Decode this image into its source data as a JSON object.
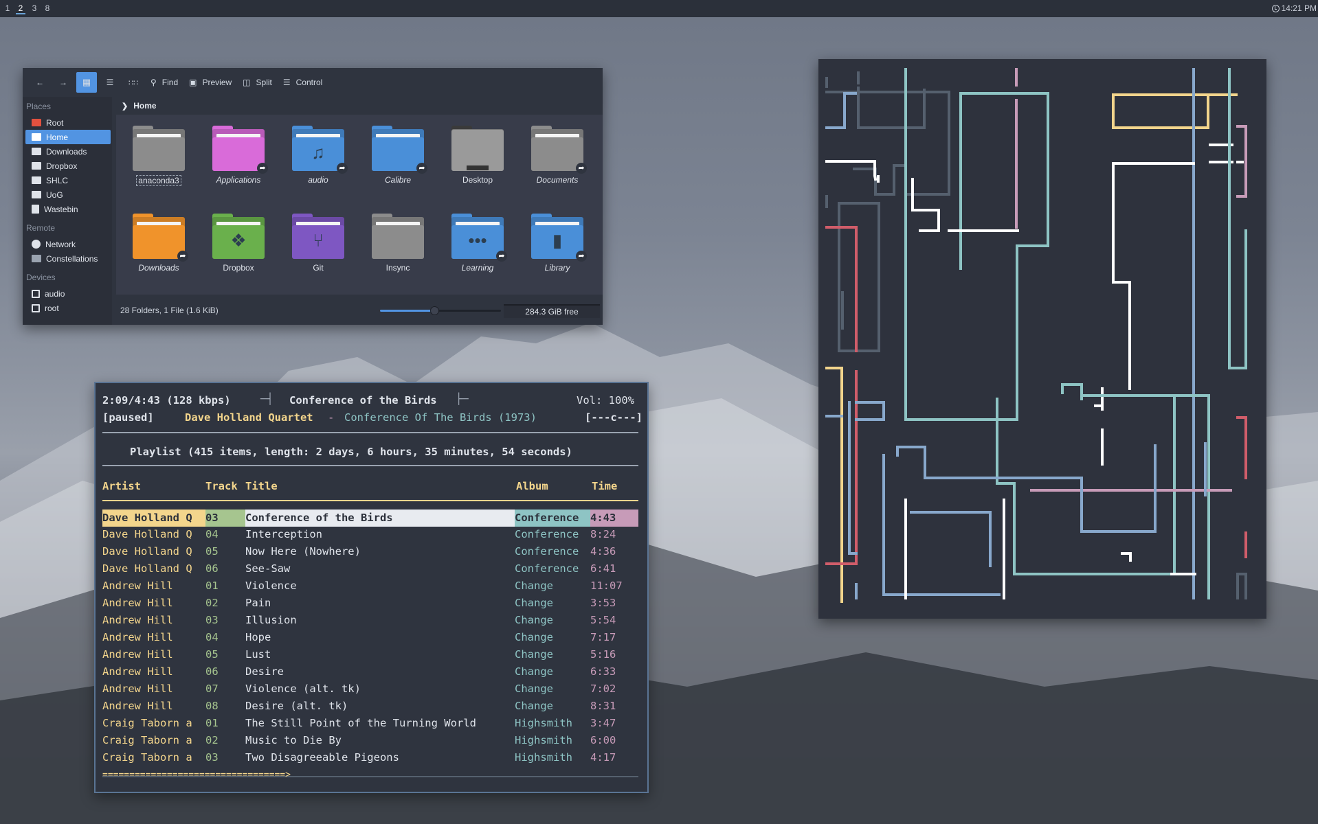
{
  "topbar": {
    "workspaces": [
      "1",
      "2",
      "3",
      "8"
    ],
    "active_workspace": "2",
    "clock": "14:21 PM"
  },
  "file_manager": {
    "toolbar": {
      "find": "Find",
      "preview": "Preview",
      "split": "Split",
      "control": "Control"
    },
    "sidebar": {
      "places_header": "Places",
      "places": [
        {
          "label": "Root",
          "icon": "folder-red-icon"
        },
        {
          "label": "Home",
          "icon": "home-icon",
          "selected": true
        },
        {
          "label": "Downloads",
          "icon": "folder-icon"
        },
        {
          "label": "Dropbox",
          "icon": "folder-icon"
        },
        {
          "label": "SHLC",
          "icon": "folder-icon"
        },
        {
          "label": "UoG",
          "icon": "folder-icon"
        },
        {
          "label": "Wastebin",
          "icon": "trash-icon"
        }
      ],
      "remote_header": "Remote",
      "remote": [
        {
          "label": "Network",
          "icon": "globe-icon"
        },
        {
          "label": "Constellations",
          "icon": "server-icon"
        }
      ],
      "devices_header": "Devices",
      "devices": [
        {
          "label": "audio",
          "icon": "drive-icon"
        },
        {
          "label": "root",
          "icon": "drive-icon"
        }
      ]
    },
    "breadcrumb": "Home",
    "items": [
      {
        "name": "anaconda3",
        "color": "#8c8c8c"
      },
      {
        "name": "Applications",
        "color": "#d96bd9"
      },
      {
        "name": "audio",
        "color": "#4a8fd8"
      },
      {
        "name": "Calibre",
        "color": "#4a8fd8"
      },
      {
        "name": "Desktop",
        "color": "#8c8c8c"
      },
      {
        "name": "Documents",
        "color": "#8c8c8c"
      },
      {
        "name": "Downloads",
        "color": "#f0932b"
      },
      {
        "name": "Dropbox",
        "color": "#6ab04c"
      },
      {
        "name": "Git",
        "color": "#7e57c2"
      },
      {
        "name": "Insync",
        "color": "#8c8c8c"
      },
      {
        "name": "Learning",
        "color": "#4a8fd8"
      },
      {
        "name": "Library",
        "color": "#4a8fd8"
      }
    ],
    "status": "28 Folders, 1 File (1.6 KiB)",
    "zoom_level": 0.45,
    "free_space": "284.3 GiB free"
  },
  "player": {
    "time": "2:09/4:43 (128 kbps)",
    "title": "Conference of the Birds",
    "volume": "Vol: 100%",
    "state": "[paused]",
    "artist": "Dave Holland Quartet",
    "dash": "-",
    "album_line": "Conference Of The Birds (1973)",
    "flags": "[---c---]",
    "playlist_summary": "Playlist (415 items, length: 2 days, 6 hours, 35 minutes, 54 seconds)",
    "columns": {
      "artist": "Artist",
      "track": "Track",
      "title": "Title",
      "album": "Album",
      "time": "Time"
    },
    "rows": [
      {
        "artist": "Dave Holland Q",
        "track": "03",
        "title": "Conference of the Birds",
        "album": "Conference",
        "time": "4:43",
        "current": true
      },
      {
        "artist": "Dave Holland Q",
        "track": "04",
        "title": "Interception",
        "album": "Conference",
        "time": "8:24"
      },
      {
        "artist": "Dave Holland Q",
        "track": "05",
        "title": "Now Here (Nowhere)",
        "album": "Conference",
        "time": "4:36"
      },
      {
        "artist": "Dave Holland Q",
        "track": "06",
        "title": "See-Saw",
        "album": "Conference",
        "time": "6:41"
      },
      {
        "artist": "Andrew Hill",
        "track": "01",
        "title": "Violence",
        "album": "Change",
        "time": "11:07"
      },
      {
        "artist": "Andrew Hill",
        "track": "02",
        "title": "Pain",
        "album": "Change",
        "time": "3:53"
      },
      {
        "artist": "Andrew Hill",
        "track": "03",
        "title": "Illusion",
        "album": "Change",
        "time": "5:54"
      },
      {
        "artist": "Andrew Hill",
        "track": "04",
        "title": "Hope",
        "album": "Change",
        "time": "7:17"
      },
      {
        "artist": "Andrew Hill",
        "track": "05",
        "title": "Lust",
        "album": "Change",
        "time": "5:16"
      },
      {
        "artist": "Andrew Hill",
        "track": "06",
        "title": "Desire",
        "album": "Change",
        "time": "6:33"
      },
      {
        "artist": "Andrew Hill",
        "track": "07",
        "title": "Violence (alt. tk)",
        "album": "Change",
        "time": "7:02"
      },
      {
        "artist": "Andrew Hill",
        "track": "08",
        "title": "Desire (alt. tk)",
        "album": "Change",
        "time": "8:31"
      },
      {
        "artist": "Craig Taborn a",
        "track": "01",
        "title": "The Still Point of the Turning World",
        "album": "Highsmith",
        "time": "3:47"
      },
      {
        "artist": "Craig Taborn a",
        "track": "02",
        "title": "Music to Die By",
        "album": "Highsmith",
        "time": "6:00"
      },
      {
        "artist": "Craig Taborn a",
        "track": "03",
        "title": "Two Disagreeable Pigeons",
        "album": "Highsmith",
        "time": "4:17"
      }
    ],
    "progress_bar": "==================================>",
    "colors": {
      "artist": "#f3d58c",
      "track": "#a6c58f",
      "album": "#8ec4c4",
      "time": "#c79bb8"
    }
  },
  "art": {
    "palette": [
      "#8ec4c4",
      "#88a8cc",
      "#f3d58c",
      "#c79bb8",
      "#d05d6a",
      "#ffffff",
      "#55606e"
    ]
  }
}
